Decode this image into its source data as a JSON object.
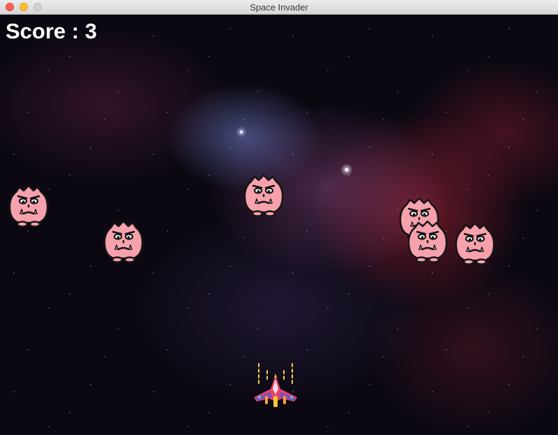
{
  "window": {
    "title": "Space Invader"
  },
  "hud": {
    "score_label": "Score : 3"
  },
  "colors": {
    "monster_fill": "#f7a1ad",
    "monster_outline": "#151515",
    "score_text": "#ffffff",
    "ship_body": "#e2446e",
    "ship_accent": "#f6c430"
  },
  "entities": {
    "enemies": [
      "enemy-monster",
      "enemy-monster",
      "enemy-monster",
      "enemy-monster",
      "enemy-monster",
      "enemy-monster"
    ],
    "player": "player-spaceship"
  }
}
